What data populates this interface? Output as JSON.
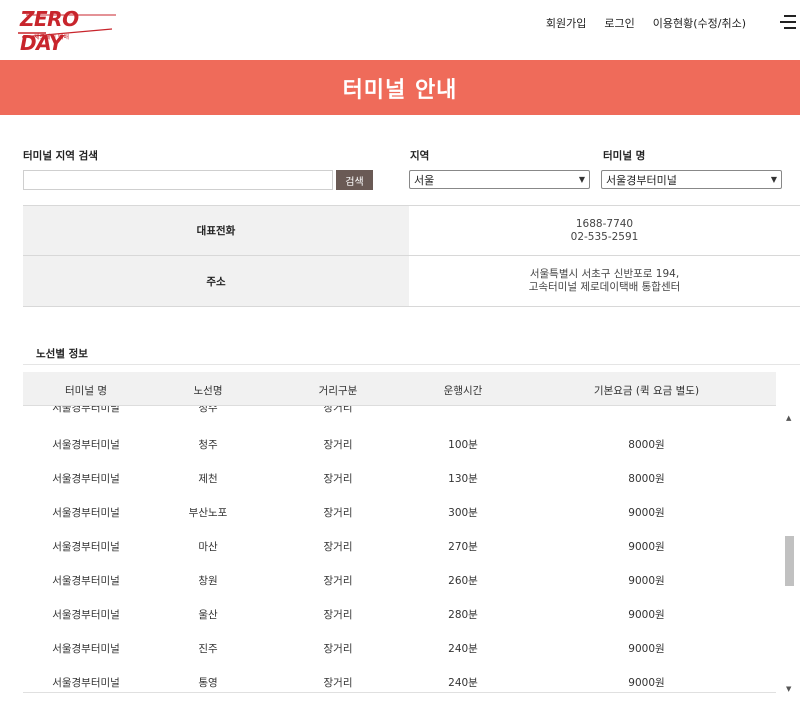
{
  "header": {
    "logo_text": "ZERO DAY",
    "logo_sub": "제로데이 택배",
    "nav": [
      "회원가입",
      "로그인",
      "이용현황(수정/취소)"
    ]
  },
  "banner": {
    "title": "터미널 안내"
  },
  "search": {
    "region_search_label": "터미널 지역 검색",
    "search_value": "",
    "search_button": "검색",
    "region_label": "지역",
    "region_value": "서울",
    "terminal_label": "터미널 명",
    "terminal_value": "서울경부터미널"
  },
  "info": {
    "phone_label": "대표전화",
    "phone_1": "1688-7740",
    "phone_2": "02-535-2591",
    "address_label": "주소",
    "address_1": "서울특별시 서초구 신반포로 194,",
    "address_2": "고속터미널 제로데이택배 통합센터"
  },
  "routes": {
    "title": "노선별 정보",
    "columns": [
      "터미널 명",
      "노선명",
      "거리구분",
      "운행시간",
      "기본요금 (퀵 요금 별도)"
    ],
    "partial_row": [
      "서울경부터미널",
      "청주",
      "장거리",
      "",
      ""
    ],
    "rows": [
      [
        "서울경부터미널",
        "청주",
        "장거리",
        "100분",
        "8000원"
      ],
      [
        "서울경부터미널",
        "제천",
        "장거리",
        "130분",
        "8000원"
      ],
      [
        "서울경부터미널",
        "부산노포",
        "장거리",
        "300분",
        "9000원"
      ],
      [
        "서울경부터미널",
        "마산",
        "장거리",
        "270분",
        "9000원"
      ],
      [
        "서울경부터미널",
        "창원",
        "장거리",
        "260분",
        "9000원"
      ],
      [
        "서울경부터미널",
        "울산",
        "장거리",
        "280분",
        "9000원"
      ],
      [
        "서울경부터미널",
        "진주",
        "장거리",
        "240분",
        "9000원"
      ],
      [
        "서울경부터미널",
        "통영",
        "장거리",
        "240분",
        "9000원"
      ]
    ]
  },
  "colors": {
    "accent": "#ef6b5a",
    "brand": "#c8252c",
    "button": "#6a5a55"
  }
}
